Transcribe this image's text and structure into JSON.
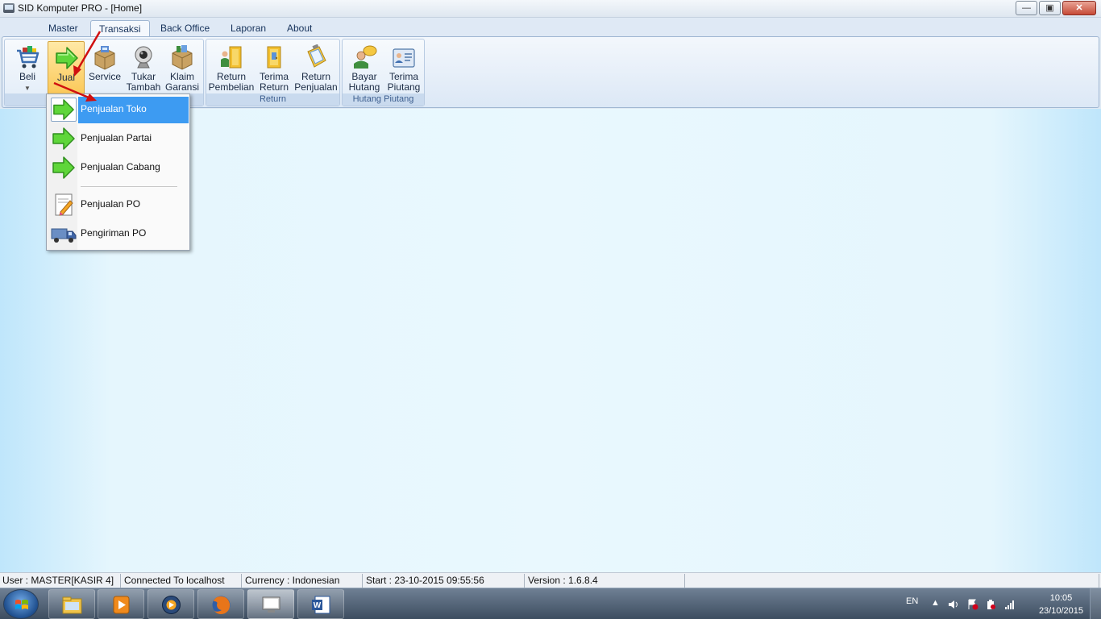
{
  "window": {
    "title": "SID Komputer PRO - [Home]",
    "controls": [
      "minimize",
      "maximize",
      "close"
    ]
  },
  "ribbon": {
    "tabs": [
      {
        "label": "Master"
      },
      {
        "label": "Transaksi",
        "active": true
      },
      {
        "label": "Back Office"
      },
      {
        "label": "Laporan"
      },
      {
        "label": "About"
      }
    ],
    "groups": [
      {
        "label": "",
        "buttons": [
          {
            "label": "Beli",
            "icon": "shopping-cart-icon",
            "has_dropdown": true
          },
          {
            "label": "Jual",
            "icon": "green-arrow-icon",
            "pressed": true
          },
          {
            "label": "Service",
            "icon": "box-icon"
          },
          {
            "label": "Tukar Tambah",
            "icon": "webcam-icon"
          },
          {
            "label": "Klaim Garansi",
            "icon": "box-icon"
          }
        ]
      },
      {
        "label": "Return",
        "buttons": [
          {
            "label": "Return Pembelian",
            "icon": "door-people-icon"
          },
          {
            "label": "Terima Return",
            "icon": "door-icon"
          },
          {
            "label": "Return Penjualan",
            "icon": "clipboard-icon"
          }
        ]
      },
      {
        "label": "Hutang Piutang",
        "buttons": [
          {
            "label": "Bayar Hutang",
            "icon": "person-speech-icon"
          },
          {
            "label": "Terima Piutang",
            "icon": "id-card-icon"
          }
        ]
      }
    ]
  },
  "jual_menu": {
    "items": [
      {
        "label": "Penjualan Toko",
        "icon": "green-arrow-icon",
        "selected": true
      },
      {
        "label": "Penjualan Partai",
        "icon": "green-arrow-icon"
      },
      {
        "label": "Penjualan Cabang",
        "icon": "green-arrow-icon"
      },
      {
        "label": "Penjualan PO",
        "icon": "notepad-pencil-icon"
      },
      {
        "label": "Pengiriman PO",
        "icon": "truck-icon"
      }
    ]
  },
  "status": {
    "user": "User : MASTER[KASIR 4]",
    "connection": "Connected To localhost",
    "currency": "Currency : Indonesian",
    "start": "Start  : 23-10-2015 09:55:56",
    "version": "Version : 1.6.8.4"
  },
  "taskbar": {
    "apps": [
      "explorer-icon",
      "media-player-icon",
      "media-center-icon",
      "firefox-icon",
      "sid-komputer-icon",
      "word-icon"
    ],
    "active_app": "sid-komputer-icon",
    "language": "EN",
    "time": "10:05",
    "date": "23/10/2015"
  },
  "colors": {
    "ribbon_border": "#9fb6d2",
    "pressed_button": "#fbc95a",
    "menu_highlight": "#3d9bf2",
    "workspace": "#e9f8fe"
  }
}
